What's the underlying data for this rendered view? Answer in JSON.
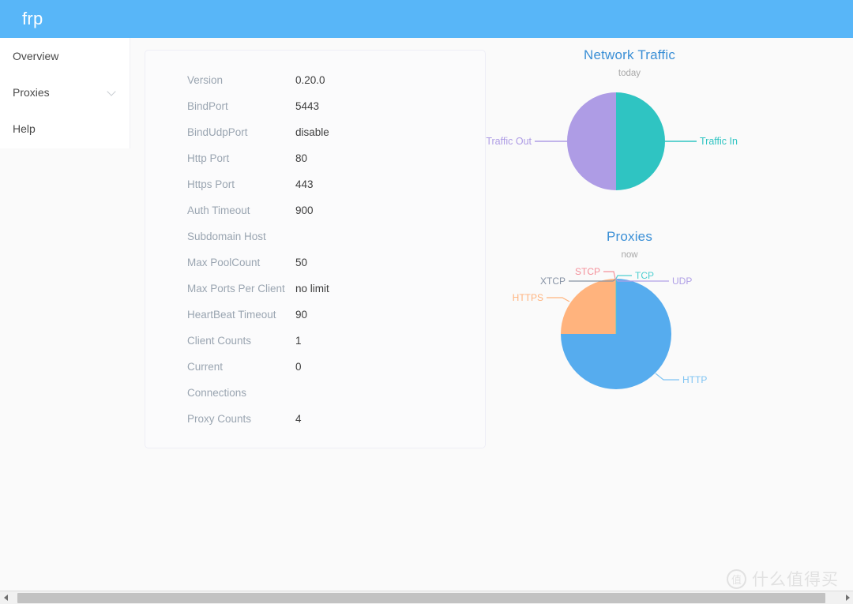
{
  "header": {
    "brand": "frp"
  },
  "sidebar": {
    "items": [
      {
        "label": "Overview",
        "icon": null
      },
      {
        "label": "Proxies",
        "icon": "chevron-down-icon"
      },
      {
        "label": "Help",
        "icon": null
      }
    ]
  },
  "server_info": {
    "rows": [
      {
        "label": "Version",
        "value": "0.20.0"
      },
      {
        "label": "BindPort",
        "value": "5443"
      },
      {
        "label": "BindUdpPort",
        "value": "disable"
      },
      {
        "label": "Http Port",
        "value": "80"
      },
      {
        "label": "Https Port",
        "value": "443"
      },
      {
        "label": "Auth Timeout",
        "value": "900"
      },
      {
        "label": "Subdomain Host",
        "value": ""
      },
      {
        "label": "Max PoolCount",
        "value": "50"
      },
      {
        "label": "Max Ports Per Client",
        "value": "no limit"
      },
      {
        "label": "HeartBeat Timeout",
        "value": "90"
      },
      {
        "label": "Client Counts",
        "value": "1"
      },
      {
        "label": "Current",
        "value": "0"
      },
      {
        "label": "Connections",
        "value": ""
      },
      {
        "label": "Proxy Counts",
        "value": "4"
      }
    ]
  },
  "chart_data": [
    {
      "type": "pie",
      "title": "Network Traffic",
      "subtitle": "today",
      "categories": [
        "Traffic In",
        "Traffic Out"
      ],
      "values": [
        50,
        50
      ],
      "colors": [
        "#2fc4c2",
        "#ae9ce5"
      ],
      "legend": "labels-with-leader-lines",
      "labels": [
        {
          "name": "Traffic In",
          "color": "#2fc4c2",
          "side": "right"
        },
        {
          "name": "Traffic Out",
          "color": "#ae9ce5",
          "side": "left"
        }
      ]
    },
    {
      "type": "pie",
      "title": "Proxies",
      "subtitle": "now",
      "categories": [
        "TCP",
        "UDP",
        "HTTP",
        "HTTPS",
        "STCP",
        "XTCP"
      ],
      "values": [
        0,
        0,
        3,
        1,
        0,
        0
      ],
      "colors": [
        "#4ecfd0",
        "#ae9ce5",
        "#56ACEE",
        "#ffb37d",
        "#f4909a",
        "#7f8fa6"
      ],
      "legend": "labels-with-leader-lines",
      "labels": [
        {
          "name": "STCP",
          "color": "#f4909a"
        },
        {
          "name": "TCP",
          "color": "#4ecfd0"
        },
        {
          "name": "XTCP",
          "color": "#8793a5"
        },
        {
          "name": "UDP",
          "color": "#b0a0e6"
        },
        {
          "name": "HTTPS",
          "color": "#ffb37d"
        },
        {
          "name": "HTTP",
          "color": "#7fc4f3"
        }
      ]
    }
  ],
  "watermark": {
    "mark": "值",
    "text": "什么值得买"
  },
  "scrollbar": {
    "left_arrow": "◀",
    "right_arrow": "▶"
  },
  "colors": {
    "header_blue": "#58b6f8",
    "title_blue": "#3a8fd6",
    "label_gray": "#9aa5b1"
  }
}
